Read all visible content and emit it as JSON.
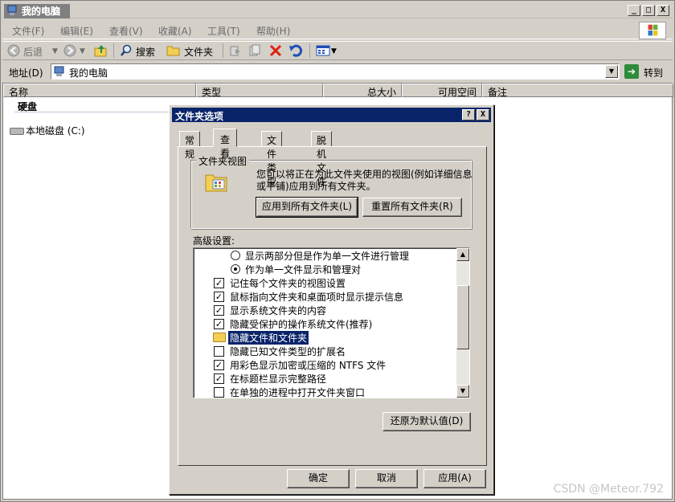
{
  "window": {
    "title": "我的电脑",
    "minimize": "_",
    "maximize": "□",
    "close": "X"
  },
  "menu": [
    {
      "label": "文件(F)"
    },
    {
      "label": "编辑(E)"
    },
    {
      "label": "查看(V)"
    },
    {
      "label": "收藏(A)"
    },
    {
      "label": "工具(T)"
    },
    {
      "label": "帮助(H)"
    }
  ],
  "toolbar": {
    "back": "后退",
    "search": "搜索",
    "folders": "文件夹"
  },
  "address": {
    "label": "地址(D)",
    "value": "我的电脑",
    "go": "转到"
  },
  "columns": [
    "名称",
    "类型",
    "总大小",
    "可用空间",
    "备注"
  ],
  "group": "硬盘",
  "drive": "本地磁盘 (C:)",
  "dialog": {
    "title": "文件夹选项",
    "help": "?",
    "close": "X",
    "tabs": [
      "常规",
      "查看",
      "文件类型",
      "脱机文件"
    ],
    "active_tab": 1,
    "folder_views": {
      "legend": "文件夹视图",
      "description": "您可以将正在为此文件夹使用的视图(例如详细信息或平铺)应用到所有文件夹。",
      "apply_all": "应用到所有文件夹(L)",
      "reset_all": "重置所有文件夹(R)"
    },
    "advanced_label": "高级设置:",
    "advanced_items": [
      {
        "kind": "radio",
        "checked": false,
        "indent": 1,
        "label": "显示两部分但是作为单一文件进行管理"
      },
      {
        "kind": "radio",
        "checked": true,
        "indent": 1,
        "label": "作为单一文件显示和管理对"
      },
      {
        "kind": "check",
        "checked": true,
        "indent": 0,
        "label": "记住每个文件夹的视图设置"
      },
      {
        "kind": "check",
        "checked": true,
        "indent": 0,
        "label": "鼠标指向文件夹和桌面项时显示提示信息"
      },
      {
        "kind": "check",
        "checked": true,
        "indent": 0,
        "label": "显示系统文件夹的内容"
      },
      {
        "kind": "check",
        "checked": true,
        "indent": 0,
        "label": "隐藏受保护的操作系统文件(推荐)"
      },
      {
        "kind": "folder",
        "checked": false,
        "indent": 0,
        "label": "隐藏文件和文件夹",
        "selected": true
      },
      {
        "kind": "check",
        "checked": false,
        "indent": 0,
        "label": "隐藏已知文件类型的扩展名"
      },
      {
        "kind": "check",
        "checked": true,
        "indent": 0,
        "label": "用彩色显示加密或压缩的 NTFS 文件"
      },
      {
        "kind": "check",
        "checked": true,
        "indent": 0,
        "label": "在标题栏显示完整路径"
      },
      {
        "kind": "check",
        "checked": false,
        "indent": 0,
        "label": "在单独的进程中打开文件夹窗口"
      }
    ],
    "restore_defaults": "还原为默认值(D)",
    "ok": "确定",
    "cancel": "取消",
    "apply": "应用(A)"
  },
  "watermark": "CSDN @Meteor.792"
}
